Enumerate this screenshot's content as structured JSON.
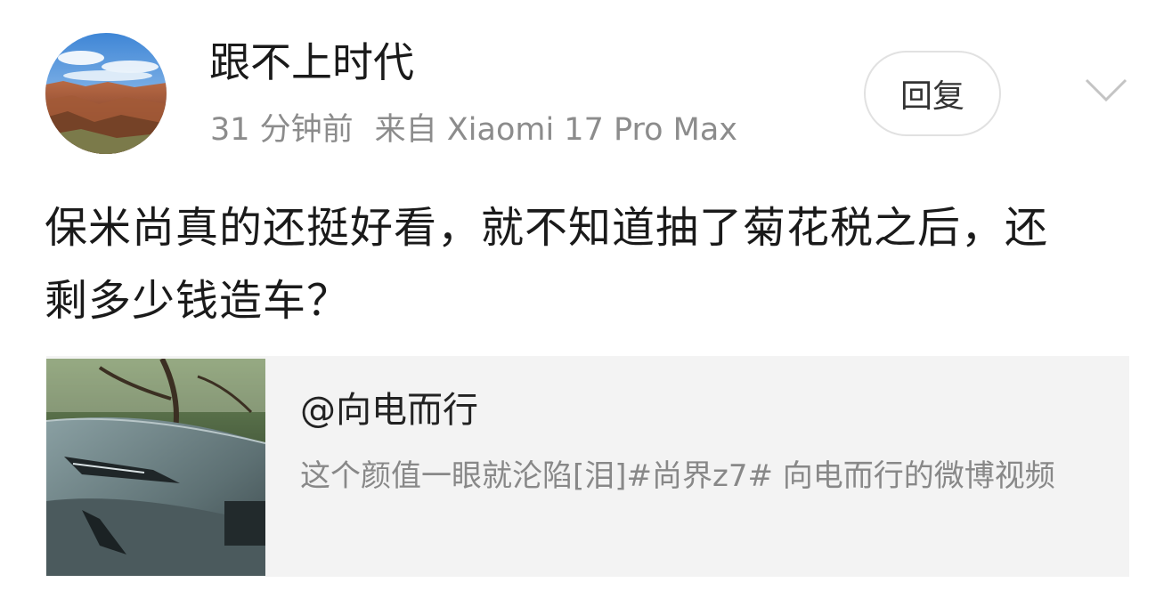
{
  "post": {
    "author": "跟不上时代",
    "time": "31 分钟前",
    "source": "来自 Xiaomi 17 Pro Max",
    "reply_label": "回复",
    "text": "保米尚真的还挺好看，就不知道抽了菊花税之后，还剩多少钱造车？"
  },
  "card": {
    "title": "@向电而行",
    "description": "这个颜值一眼就沦陷[泪]#尚界z7# 向电而行的微博视频"
  },
  "icons": {
    "more": "chevron-down-icon"
  }
}
